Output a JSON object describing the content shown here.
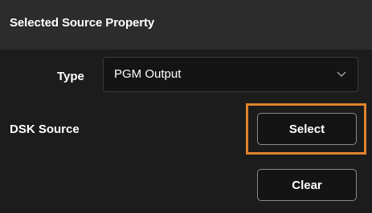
{
  "panel": {
    "title": "Selected Source Property"
  },
  "type_field": {
    "label": "Type",
    "selected_value": "PGM Output",
    "dropdown_icon": "chevron-down-icon"
  },
  "dsk_source": {
    "label": "DSK Source",
    "select_label": "Select",
    "clear_label": "Clear"
  },
  "colors": {
    "highlight": "#e2832b",
    "header_bg": "#2c2c2c",
    "panel_bg": "#1c1c1c"
  }
}
